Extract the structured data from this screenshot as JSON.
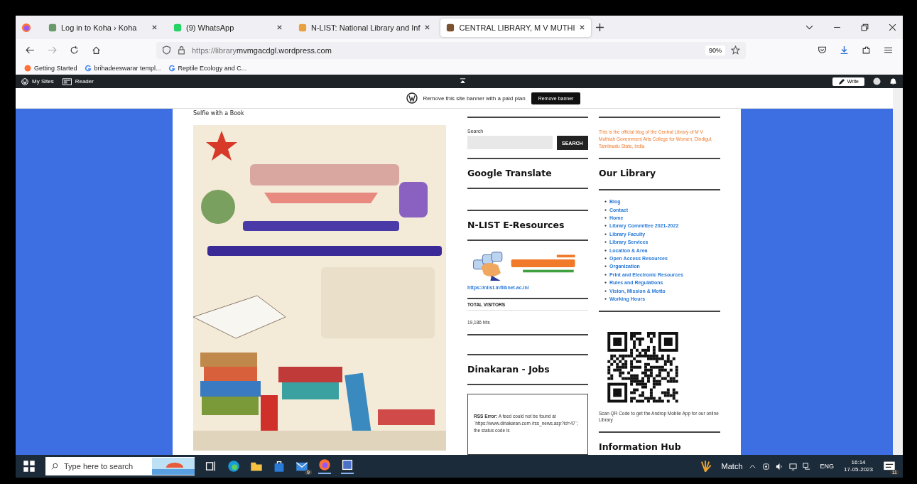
{
  "tabs": [
    {
      "label": "Log in to Koha › Koha",
      "selected": false
    },
    {
      "label": "(9) WhatsApp",
      "selected": false
    },
    {
      "label": "N-LIST: National Library and Inf",
      "selected": false
    },
    {
      "label": "CENTRAL LIBRARY, M V MUTHI",
      "selected": true
    }
  ],
  "address_bar": {
    "url_prefix": "https://library",
    "url_host": "mvmgacdgl.wordpress.com",
    "zoom": "90%"
  },
  "bookmarks": [
    "Getting Started",
    "brihadeeswarar templ...",
    "Reptile Ecology and C..."
  ],
  "admin_bar": {
    "my_sites": "My Sites",
    "reader": "Reader",
    "write": "Write"
  },
  "banner": {
    "text": "Remove this site banner with a paid plan",
    "button": "Remove banner"
  },
  "post": {
    "caption": "Selfie with a Book"
  },
  "middle": {
    "search_label": "Search",
    "search_button": "SEARCH",
    "translate_title": "Google Translate",
    "nlist_title": "N-LIST E-Resources",
    "nlist_link": "https://nlist.inflibnet.ac.in/",
    "visitors_title": "TOTAL VISITORS",
    "visitors_count": "19,186 hits",
    "jobs_title": "Dinakaran - Jobs",
    "rss_text": "**RSS Error:** A feed could not be found at `https://www.dinakaran.com /rss_news.asp?id=47`; the status code is"
  },
  "right": {
    "about": "This is the official blog of the Central Library of M V Muthiah Government Arts College for Women, Dindigul, Tamilnadu State, India",
    "library_title": "Our Library",
    "links": [
      "Blog",
      "Contact",
      "Home",
      "Library Committee 2021-2022",
      "Library Faculty",
      "Library Services",
      "Location & Area",
      "Open Access Resources",
      "Organization",
      "Print and Electronic Resources",
      "Rules and Regulations",
      "Vision, Mission & Motto",
      "Working Hours"
    ],
    "qr_caption": "Scan QR Code to get the Androp Mobile App for our online Library",
    "hub_title": "Information Hub"
  },
  "taskbar": {
    "search_placeholder": "Type here to search",
    "mail_badge": "9",
    "weather": "Match",
    "language": "ENG",
    "time": "16:14",
    "date": "17-05-2023",
    "notifications": "11"
  }
}
